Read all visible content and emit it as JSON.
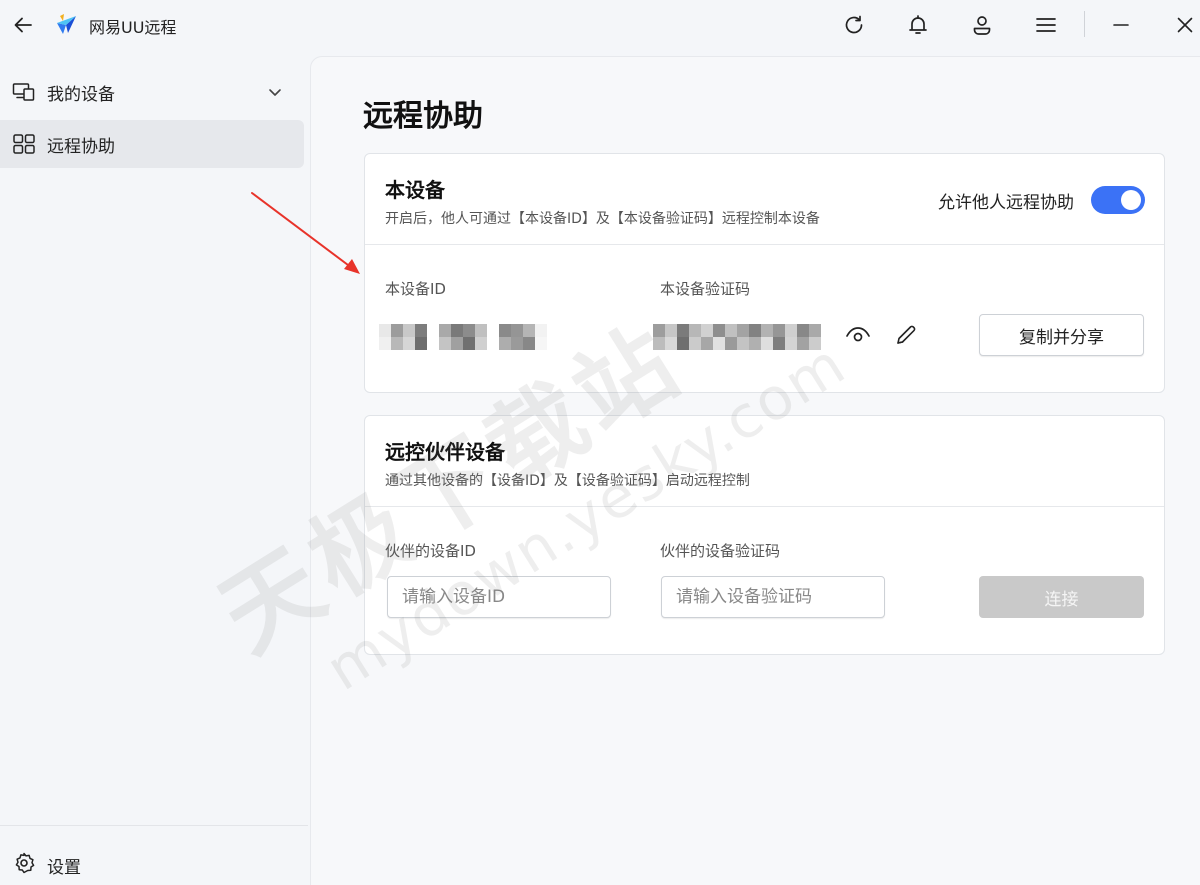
{
  "app": {
    "title": "网易UU远程"
  },
  "titlebar": {
    "icons": [
      "back-arrow-icon",
      "refresh-icon",
      "bell-icon",
      "user-icon",
      "menu-icon",
      "minimize-icon",
      "close-icon"
    ]
  },
  "sidebar": {
    "items": [
      {
        "label": "我的设备",
        "icon": "devices-icon",
        "expandable": true,
        "active": false
      },
      {
        "label": "远程协助",
        "icon": "grid-icon",
        "active": true
      }
    ],
    "settings_label": "设置"
  },
  "main": {
    "page_title": "远程协助",
    "this_device": {
      "title": "本设备",
      "description": "开启后，他人可通过【本设备ID】及【本设备验证码】远程控制本设备",
      "toggle_label": "允许他人远程协助",
      "toggle_on": true,
      "id_label": "本设备ID",
      "code_label": "本设备验证码",
      "copy_share_label": "复制并分享"
    },
    "partner_device": {
      "title": "远控伙伴设备",
      "description": "通过其他设备的【设备ID】及【设备验证码】启动远程控制",
      "id_label": "伙伴的设备ID",
      "id_placeholder": "请输入设备ID",
      "code_label": "伙伴的设备验证码",
      "code_placeholder": "请输入设备验证码",
      "connect_label": "连接"
    }
  },
  "watermark": {
    "cn": "天极下载站",
    "en": "mydown.yesky.com"
  },
  "colors": {
    "accent": "#3b72f6",
    "annotation": "#e8332a",
    "disabled_button": "#c9c9c9"
  }
}
